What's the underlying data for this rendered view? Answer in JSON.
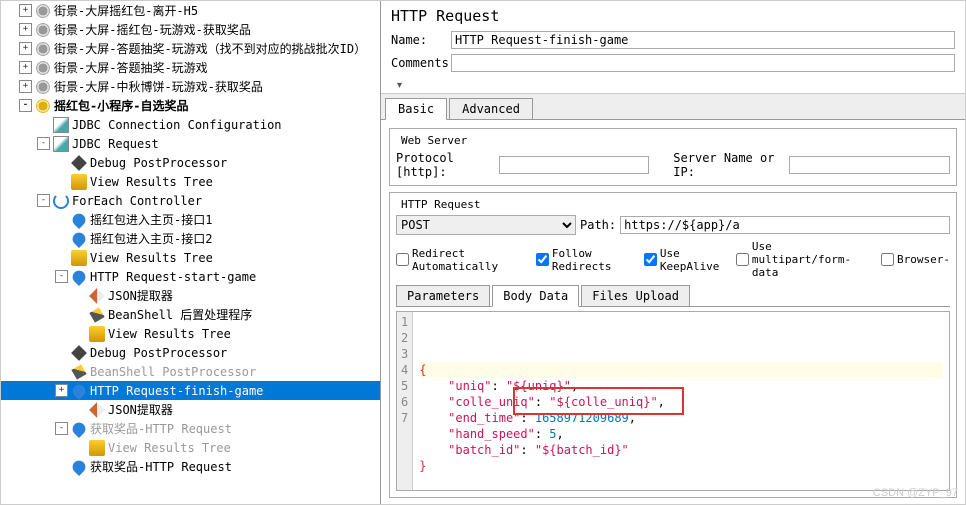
{
  "tree": [
    {
      "ind": 1,
      "tog": "+",
      "ic": "gear",
      "txt": "街景-大屏摇红包-离开-H5"
    },
    {
      "ind": 1,
      "tog": "+",
      "ic": "gear",
      "txt": "街景-大屏-摇红包-玩游戏-获取奖品"
    },
    {
      "ind": 1,
      "tog": "+",
      "ic": "gear",
      "txt": "街景-大屏-答题抽奖-玩游戏（找不到对应的挑战批次ID）"
    },
    {
      "ind": 1,
      "tog": "+",
      "ic": "gear",
      "txt": "街景-大屏-答题抽奖-玩游戏"
    },
    {
      "ind": 1,
      "tog": "+",
      "ic": "gear",
      "txt": "街景-大屏-中秋博饼-玩游戏-获取奖品"
    },
    {
      "ind": 1,
      "tog": "-",
      "ic": "gear-y",
      "txt": "摇红包-小程序-自选奖品",
      "bold": true
    },
    {
      "ind": 2,
      "tog": "",
      "ic": "vial",
      "txt": "JDBC Connection Configuration"
    },
    {
      "ind": 2,
      "tog": "-",
      "ic": "vial",
      "txt": "JDBC Request"
    },
    {
      "ind": 3,
      "tog": "",
      "ic": "diamond",
      "txt": "Debug PostProcessor"
    },
    {
      "ind": 3,
      "tog": "",
      "ic": "gold",
      "txt": "View Results Tree"
    },
    {
      "ind": 2,
      "tog": "-",
      "ic": "loop",
      "txt": "ForEach Controller"
    },
    {
      "ind": 3,
      "tog": "",
      "ic": "drop",
      "txt": "摇红包进入主页-接口1"
    },
    {
      "ind": 3,
      "tog": "",
      "ic": "drop",
      "txt": "摇红包进入主页-接口2"
    },
    {
      "ind": 3,
      "tog": "",
      "ic": "gold",
      "txt": "View Results Tree"
    },
    {
      "ind": 3,
      "tog": "-",
      "ic": "drop",
      "txt": "HTTP Request-start-game"
    },
    {
      "ind": 4,
      "tog": "",
      "ic": "pen",
      "txt": "JSON提取器"
    },
    {
      "ind": 4,
      "tog": "",
      "ic": "wand",
      "txt": "BeanShell 后置处理程序"
    },
    {
      "ind": 4,
      "tog": "",
      "ic": "gold",
      "txt": "View Results Tree"
    },
    {
      "ind": 3,
      "tog": "",
      "ic": "diamond",
      "txt": "Debug PostProcessor"
    },
    {
      "ind": 3,
      "tog": "",
      "ic": "wand",
      "txt": "BeanShell PostProcessor",
      "grey": true
    },
    {
      "ind": 3,
      "tog": "+",
      "ic": "drop",
      "txt": "HTTP Request-finish-game",
      "sel": true
    },
    {
      "ind": 4,
      "tog": "",
      "ic": "pen",
      "txt": "JSON提取器"
    },
    {
      "ind": 3,
      "tog": "-",
      "ic": "drop",
      "txt": "获取奖品-HTTP Request",
      "grey": true
    },
    {
      "ind": 4,
      "tog": "",
      "ic": "gold",
      "txt": "View Results Tree",
      "grey": true
    },
    {
      "ind": 3,
      "tog": "",
      "ic": "drop",
      "txt": "获取奖品-HTTP Request"
    }
  ],
  "panel": {
    "title": "HTTP Request",
    "name_label": "Name:",
    "name_value": "HTTP Request-finish-game",
    "comments_label": "Comments:",
    "comments_value": "",
    "tabs": [
      "Basic",
      "Advanced"
    ],
    "webserver": {
      "legend": "Web Server",
      "protocol_label": "Protocol [http]:",
      "protocol_value": "",
      "servername_label": "Server Name or IP:"
    },
    "httpreq": {
      "legend": "HTTP Request",
      "method": "POST",
      "path_label": "Path:",
      "path_value": "https://${app}/a",
      "checks": {
        "redirect_auto": {
          "label": "Redirect Automatically",
          "v": false
        },
        "follow": {
          "label": "Follow Redirects",
          "v": true
        },
        "keepalive": {
          "label": "Use KeepAlive",
          "v": true
        },
        "multipart": {
          "label": "Use multipart/form-data",
          "v": false
        },
        "browser": {
          "label": "Browser-",
          "v": false
        }
      }
    },
    "subtabs": [
      "Parameters",
      "Body Data",
      "Files Upload"
    ],
    "body_lines": [
      "{",
      "    \"uniq\": \"${uniq}\",",
      "    \"colle_uniq\": \"${colle_uniq}\",",
      "    \"end_time\": 1658971209689,",
      "    \"hand_speed\": 5,",
      "    \"batch_id\": \"${batch_id}\"",
      "}"
    ]
  },
  "watermark": "CSDN @ZYP_97"
}
